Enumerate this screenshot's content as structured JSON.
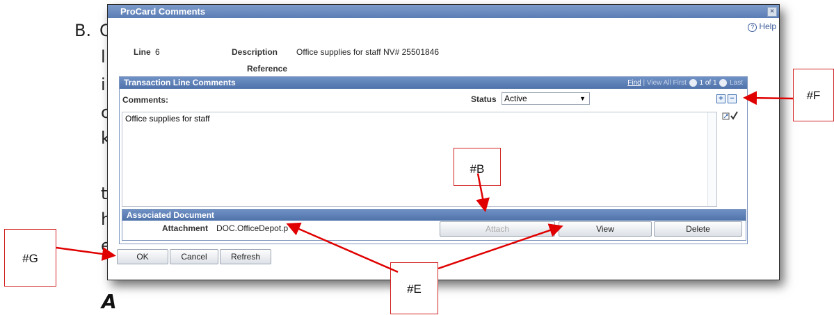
{
  "document": {
    "label": "B.",
    "fragments": [
      "C",
      "l",
      "i",
      "c",
      "k",
      "t",
      "h",
      "e"
    ],
    "footer_letter": "A"
  },
  "dialog": {
    "title": "ProCard Comments",
    "close": "×",
    "help": "Help",
    "help_icon": "?",
    "line_label": "Line",
    "line_value": "6",
    "description_label": "Description",
    "description_value": "Office supplies for staff NV# 25501846",
    "reference_label": "Reference"
  },
  "transaction": {
    "header": "Transaction Line Comments",
    "nav_find": "Find",
    "nav_view_all": "View All",
    "nav_first": "First",
    "nav_range": "1 of 1",
    "nav_last": "Last",
    "comments_label": "Comments:",
    "status_label": "Status",
    "status_value": "Active",
    "add": "+",
    "remove": "−",
    "comment_text": "Office supplies for staff"
  },
  "associated": {
    "header": "Associated Document",
    "attachment_label": "Attachment",
    "attachment_value": "DOC.OfficeDepot.p",
    "attach_button": "Attach",
    "view_button": "View",
    "delete_button": "Delete"
  },
  "footer_buttons": {
    "ok": "OK",
    "cancel": "Cancel",
    "refresh": "Refresh"
  },
  "callouts": {
    "b": "#B",
    "e": "#E",
    "f": "#F",
    "g": "#G"
  },
  "colors": {
    "title_bar": "#5a7db5",
    "callout_border": "#d32222",
    "arrow": "#e00000"
  }
}
